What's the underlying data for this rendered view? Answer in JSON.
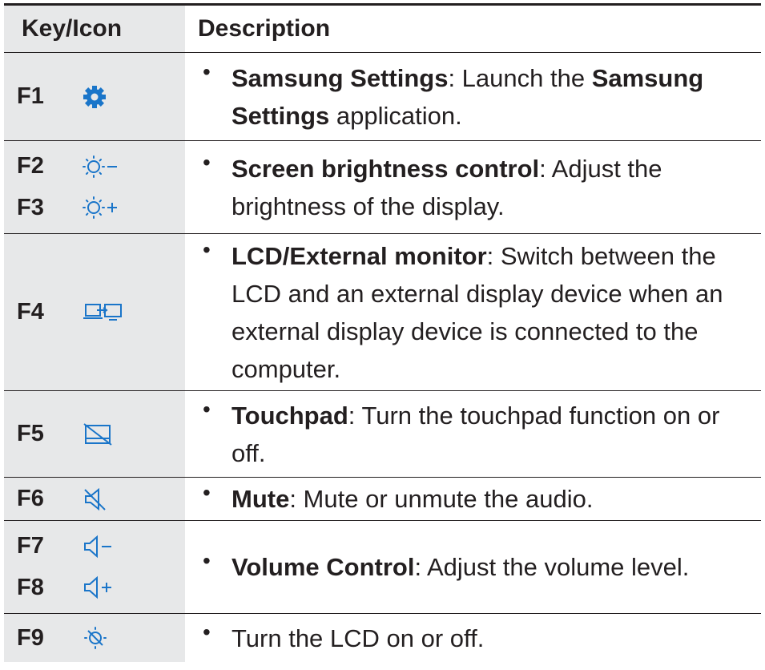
{
  "header": {
    "key": "Key/Icon",
    "description": "Description"
  },
  "accent_color": "#1a75c9",
  "rows": [
    {
      "keys": [
        {
          "label": "F1",
          "icon": "settings-gear-icon"
        }
      ],
      "bold1": "Samsung Settings",
      "sep1": ": Launch the ",
      "bold2": "Samsung Settings",
      "rest": " application."
    },
    {
      "keys": [
        {
          "label": "F2",
          "icon": "brightness-down-icon"
        },
        {
          "label": "F3",
          "icon": "brightness-up-icon"
        }
      ],
      "bold1": "Screen brightness control",
      "rest": ": Adjust the brightness of the display."
    },
    {
      "keys": [
        {
          "label": "F4",
          "icon": "lcd-external-monitor-icon"
        }
      ],
      "bold1": "LCD/External monitor",
      "rest": ": Switch between the LCD and an external display device when an external display device is connected to the computer."
    },
    {
      "keys": [
        {
          "label": "F5",
          "icon": "touchpad-off-icon"
        }
      ],
      "bold1": "Touchpad",
      "rest": ": Turn the touchpad function on or off."
    },
    {
      "keys": [
        {
          "label": "F6",
          "icon": "mute-icon"
        }
      ],
      "bold1": "Mute",
      "rest": ": Mute or unmute the audio."
    },
    {
      "keys": [
        {
          "label": "F7",
          "icon": "volume-down-icon"
        },
        {
          "label": "F8",
          "icon": "volume-up-icon"
        }
      ],
      "bold1": "Volume Control",
      "rest": ": Adjust the volume level."
    },
    {
      "keys": [
        {
          "label": "F9",
          "icon": "lcd-off-icon"
        }
      ],
      "rest": "Turn the LCD on or off."
    }
  ]
}
